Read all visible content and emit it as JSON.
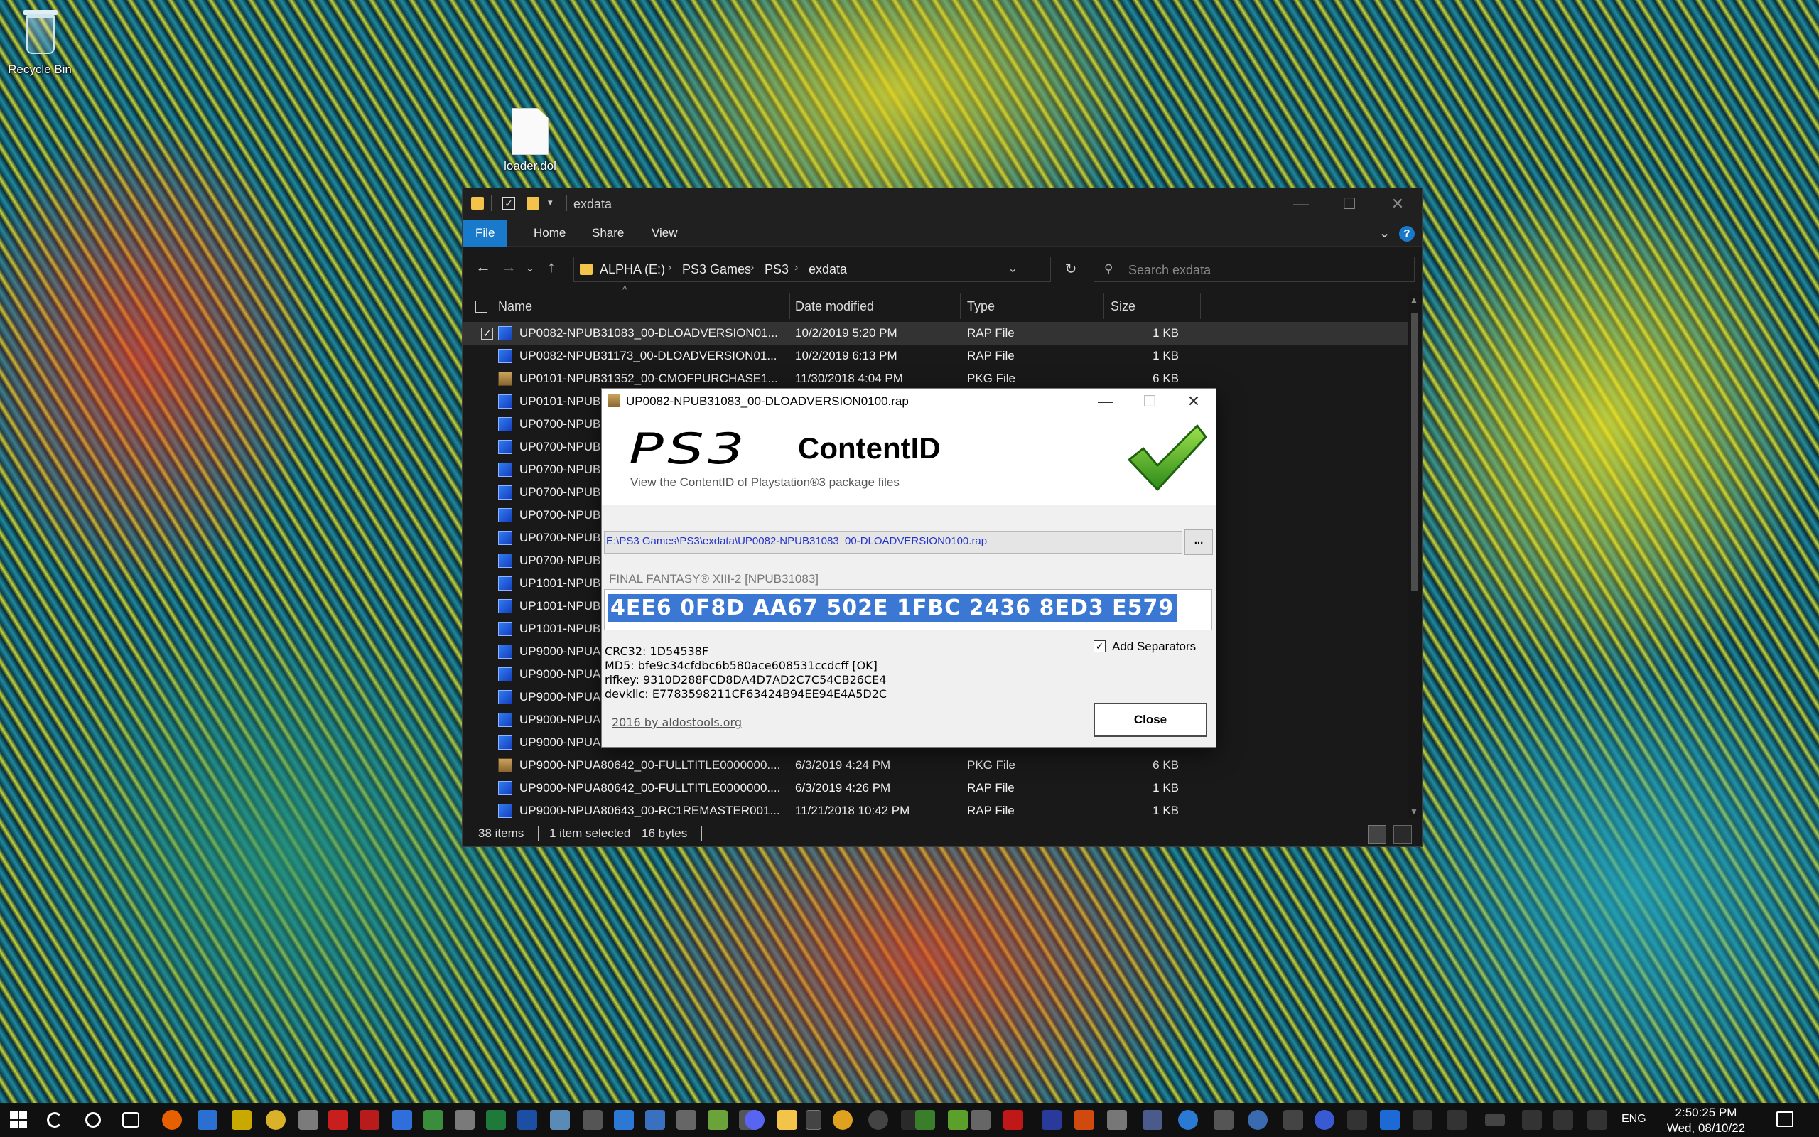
{
  "desktop": {
    "recycle_bin_label": "Recycle Bin",
    "loader_label": "loader.dol"
  },
  "explorer": {
    "title": "exdata",
    "ribbon_tabs": [
      "File",
      "Home",
      "Share",
      "View"
    ],
    "breadcrumb": [
      "ALPHA (E:)",
      "PS3 Games",
      "PS3",
      "exdata"
    ],
    "search_placeholder": "Search exdata",
    "columns": {
      "name": "Name",
      "date": "Date modified",
      "type": "Type",
      "size": "Size"
    },
    "rows": [
      {
        "name": "UP0082-NPUB31083_00-DLOADVERSION01...",
        "date": "10/2/2019 5:20 PM",
        "type": "RAP File",
        "size": "1 KB",
        "icon": "rap-file-icon",
        "selected": true
      },
      {
        "name": "UP0082-NPUB31173_00-DLOADVERSION01...",
        "date": "10/2/2019 6:13 PM",
        "type": "RAP File",
        "size": "1 KB",
        "icon": "rap-file-icon"
      },
      {
        "name": "UP0101-NPUB31352_00-CMOFPURCHASE1...",
        "date": "11/30/2018 4:04 PM",
        "type": "PKG File",
        "size": "6 KB",
        "icon": "pkg-file-icon"
      },
      {
        "name": "UP0101-NPUB",
        "date": "",
        "type": "",
        "size": "",
        "icon": "rap-file-icon"
      },
      {
        "name": "UP0700-NPUB",
        "date": "",
        "type": "",
        "size": "",
        "icon": "rap-file-icon"
      },
      {
        "name": "UP0700-NPUB",
        "date": "",
        "type": "",
        "size": "",
        "icon": "rap-file-icon"
      },
      {
        "name": "UP0700-NPUB",
        "date": "",
        "type": "",
        "size": "",
        "icon": "rap-file-icon"
      },
      {
        "name": "UP0700-NPUB",
        "date": "",
        "type": "",
        "size": "",
        "icon": "rap-file-icon"
      },
      {
        "name": "UP0700-NPUB",
        "date": "",
        "type": "",
        "size": "",
        "icon": "rap-file-icon"
      },
      {
        "name": "UP0700-NPUB",
        "date": "",
        "type": "",
        "size": "",
        "icon": "rap-file-icon"
      },
      {
        "name": "UP0700-NPUB",
        "date": "",
        "type": "",
        "size": "",
        "icon": "rap-file-icon"
      },
      {
        "name": "UP1001-NPUB",
        "date": "",
        "type": "",
        "size": "",
        "icon": "rap-file-icon"
      },
      {
        "name": "UP1001-NPUB",
        "date": "",
        "type": "",
        "size": "",
        "icon": "rap-file-icon"
      },
      {
        "name": "UP1001-NPUB",
        "date": "",
        "type": "",
        "size": "",
        "icon": "rap-file-icon"
      },
      {
        "name": "UP9000-NPUA",
        "date": "",
        "type": "",
        "size": "",
        "icon": "rap-file-icon"
      },
      {
        "name": "UP9000-NPUA",
        "date": "",
        "type": "",
        "size": "",
        "icon": "rap-file-icon"
      },
      {
        "name": "UP9000-NPUA",
        "date": "",
        "type": "",
        "size": "",
        "icon": "rap-file-icon"
      },
      {
        "name": "UP9000-NPUA",
        "date": "",
        "type": "",
        "size": "",
        "icon": "rap-file-icon"
      },
      {
        "name": "UP9000-NPUA",
        "date": "",
        "type": "",
        "size": "",
        "icon": "rap-file-icon"
      },
      {
        "name": "UP9000-NPUA80642_00-FULLTITLE0000000....",
        "date": "6/3/2019 4:24 PM",
        "type": "PKG File",
        "size": "6 KB",
        "icon": "pkg-file-icon"
      },
      {
        "name": "UP9000-NPUA80642_00-FULLTITLE0000000....",
        "date": "6/3/2019 4:26 PM",
        "type": "RAP File",
        "size": "1 KB",
        "icon": "rap-file-icon"
      },
      {
        "name": "UP9000-NPUA80643_00-RC1REMASTER001...",
        "date": "11/21/2018 10:42 PM",
        "type": "RAP File",
        "size": "1 KB",
        "icon": "rap-file-icon"
      }
    ],
    "status": {
      "items": "38 items",
      "selected": "1 item selected",
      "size": "16 bytes"
    }
  },
  "dialog": {
    "title": "UP0082-NPUB31083_00-DLOADVERSION0100.rap",
    "logo_ps3": "PS3",
    "logo_text": "ContentID",
    "tagline": "View the ContentID of Playstation®3 package files",
    "file_path": "E:\\PS3 Games\\PS3\\exdata\\UP0082-NPUB31083_00-DLOADVERSION0100.rap",
    "browse_label": "...",
    "game_title": "FINAL FANTASY® XIII-2 [NPUB31083]",
    "key": "4EE6 0F8D AA67 502E 1FBC 2436 8ED3 E579",
    "add_separators_label": "Add Separators",
    "add_separators_checked": true,
    "info": [
      "CRC32: 1D54538F",
      "MD5: bfe9c34cfdbc6b580ace608531ccdcff [OK]",
      "rifkey: 9310D288FCD8DA4D7AD2C7C54CB26CE4",
      "devklic: E7783598211CF63424B94EE94E4A5D2C"
    ],
    "credit": "2016 by aldostools.org",
    "close_label": "Close"
  },
  "taskbar": {
    "language": "ENG",
    "time": "2:50:25 PM",
    "date": "Wed, 08/10/22"
  }
}
